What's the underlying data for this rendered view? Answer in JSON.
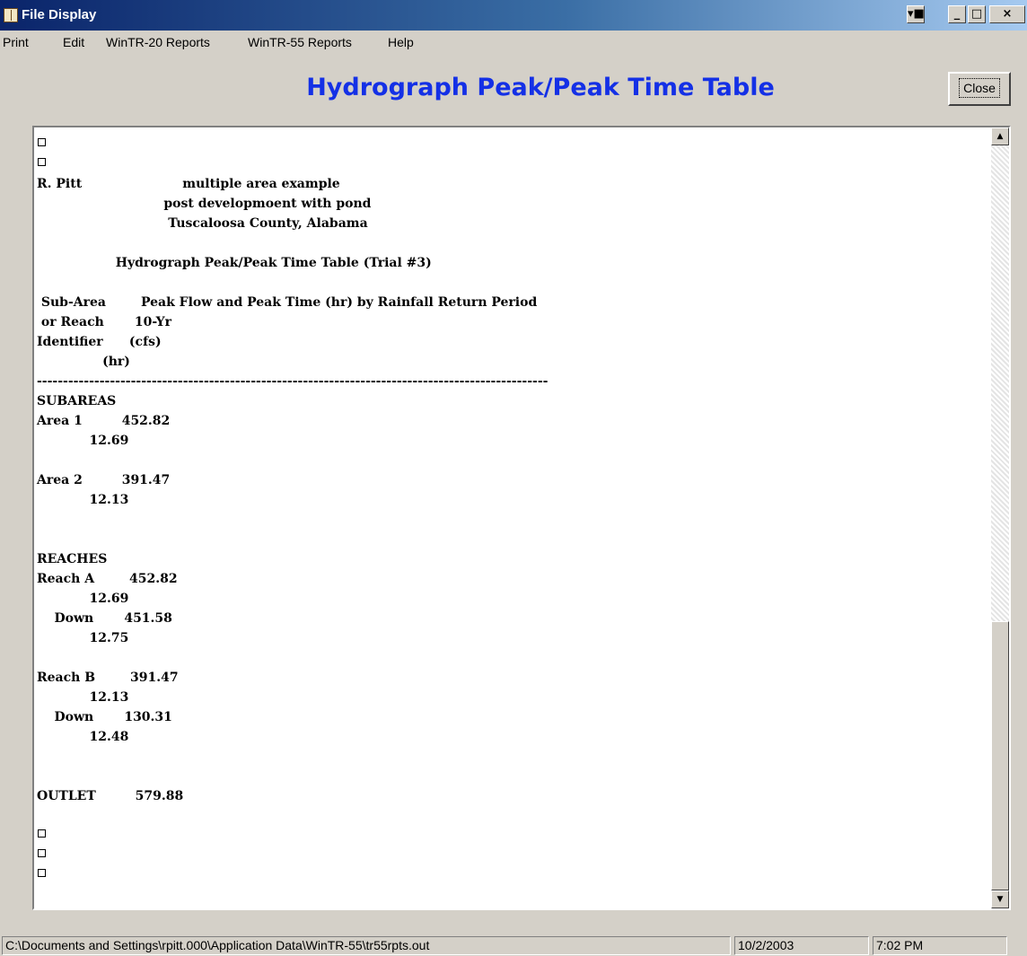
{
  "window": {
    "title": "File Display",
    "controls": [
      "▾■",
      "_",
      "□",
      "×"
    ]
  },
  "menu": [
    "Print",
    "Edit",
    "WinTR-20 Reports",
    "WinTR-55 Reports",
    "Help"
  ],
  "heading": "Hydrograph Peak/Peak Time Table",
  "close_button": "Close",
  "report": {
    "lines": [
      {
        "kind": "box"
      },
      {
        "kind": "box"
      },
      {
        "kind": "text",
        "text": "R. Pitt                       multiple area example"
      },
      {
        "kind": "text",
        "text": "                             post developmoent with pond"
      },
      {
        "kind": "text",
        "text": "                              Tuscaloosa County, Alabama"
      },
      {
        "kind": "text",
        "text": ""
      },
      {
        "kind": "text",
        "text": "                  Hydrograph Peak/Peak Time Table (Trial #3)"
      },
      {
        "kind": "text",
        "text": ""
      },
      {
        "kind": "text",
        "text": " Sub-Area        Peak Flow and Peak Time (hr) by Rainfall Return Period"
      },
      {
        "kind": "text",
        "text": " or Reach       10-Yr"
      },
      {
        "kind": "text",
        "text": "Identifier      (cfs)"
      },
      {
        "kind": "text",
        "text": "               (hr)"
      },
      {
        "kind": "text",
        "text": "--------------------------------------------------------------------------------------------------"
      },
      {
        "kind": "text",
        "text": "SUBAREAS"
      },
      {
        "kind": "text",
        "text": "Area 1         452.82"
      },
      {
        "kind": "text",
        "text": "            12.69"
      },
      {
        "kind": "text",
        "text": ""
      },
      {
        "kind": "text",
        "text": "Area 2         391.47"
      },
      {
        "kind": "text",
        "text": "            12.13"
      },
      {
        "kind": "text",
        "text": ""
      },
      {
        "kind": "text",
        "text": ""
      },
      {
        "kind": "text",
        "text": "REACHES"
      },
      {
        "kind": "text",
        "text": "Reach A        452.82"
      },
      {
        "kind": "text",
        "text": "            12.69"
      },
      {
        "kind": "text",
        "text": "    Down       451.58"
      },
      {
        "kind": "text",
        "text": "            12.75"
      },
      {
        "kind": "text",
        "text": ""
      },
      {
        "kind": "text",
        "text": "Reach B        391.47"
      },
      {
        "kind": "text",
        "text": "            12.13"
      },
      {
        "kind": "text",
        "text": "    Down       130.31"
      },
      {
        "kind": "text",
        "text": "            12.48"
      },
      {
        "kind": "text",
        "text": ""
      },
      {
        "kind": "text",
        "text": ""
      },
      {
        "kind": "text",
        "text": "OUTLET         579.88"
      },
      {
        "kind": "text",
        "text": ""
      },
      {
        "kind": "box"
      },
      {
        "kind": "box"
      },
      {
        "kind": "box"
      }
    ]
  },
  "scrollbar": {
    "up": "▲",
    "down": "▼"
  },
  "status": {
    "path": "C:\\Documents and Settings\\rpitt.000\\Application Data\\WinTR-55\\tr55rpts.out",
    "date": "10/2/2003",
    "time": "7:02 PM"
  }
}
